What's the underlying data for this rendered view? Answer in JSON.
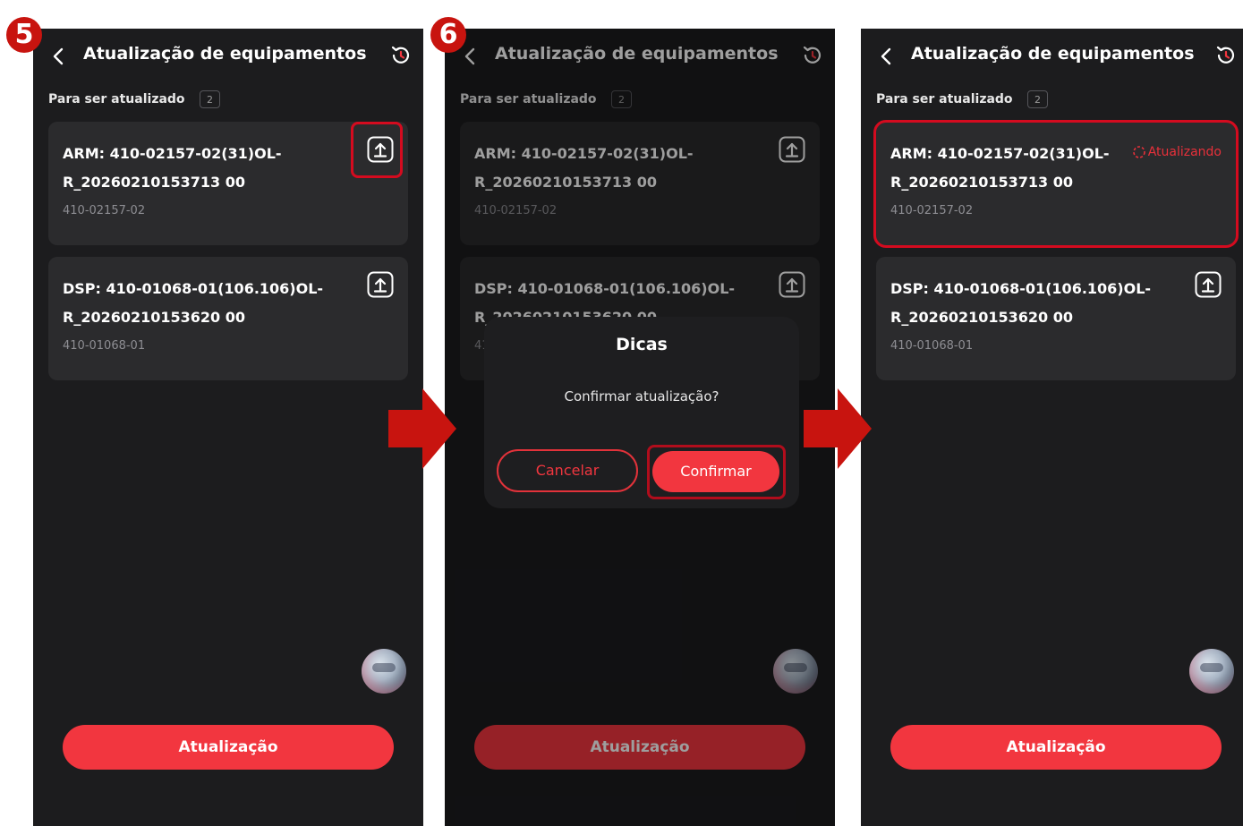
{
  "steps": [
    "5",
    "6"
  ],
  "colors": {
    "accent": "#f2363f",
    "panel_bg": "#1c1c1e",
    "card_bg": "#2b2b2d",
    "highlight": "#d40b1f",
    "arrow": "#c8140f"
  },
  "screens": [
    {
      "header_title": "Atualização de equipamentos",
      "section_label": "Para ser atualizado",
      "count": "2",
      "items": [
        {
          "title": "ARM: 410-02157-02(31)OL-R_20260210153713 00",
          "subtitle": "410-02157-02",
          "action_icon": "upload-icon"
        },
        {
          "title": "DSP: 410-01068-01(106.106)OL-R_20260210153620 00",
          "subtitle": "410-01068-01",
          "action_icon": "upload-icon"
        }
      ],
      "update_button": "Atualização"
    },
    {
      "header_title": "Atualização de equipamentos",
      "section_label": "Para ser atualizado",
      "count": "2",
      "items": [
        {
          "title": "ARM: 410-02157-02(31)OL-R_20260210153713 00",
          "subtitle": "410-02157-02",
          "action_icon": "upload-icon"
        },
        {
          "title": "DSP: 410-01068-01(106.106)OL-R_20260210153620 00",
          "subtitle": "410-01068-01",
          "action_icon": "upload-icon"
        }
      ],
      "update_button": "Atualização",
      "dialog": {
        "title": "Dicas",
        "message": "Confirmar atualização?",
        "cancel": "Cancelar",
        "confirm": "Confirmar"
      }
    },
    {
      "header_title": "Atualização de equipamentos",
      "section_label": "Para ser atualizado",
      "count": "2",
      "items": [
        {
          "title": "ARM: 410-02157-02(31)OL-R_20260210153713 00",
          "subtitle": "410-02157-02",
          "status": "Atualizando",
          "status_icon": "spinner-icon"
        },
        {
          "title": "DSP: 410-01068-01(106.106)OL-R_20260210153620 00",
          "subtitle": "410-01068-01",
          "action_icon": "upload-icon"
        }
      ],
      "update_button": "Atualização"
    }
  ]
}
